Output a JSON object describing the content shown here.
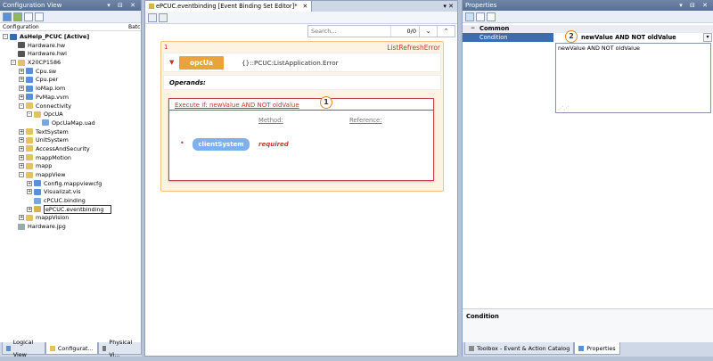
{
  "left_panel": {
    "title": "Configuration View",
    "title_controls": "▾ ⊟ ✕",
    "columns": [
      "Configuration",
      "Batc"
    ],
    "tree": [
      {
        "label": "AsHelp_PCUC [Active]",
        "indent": 1,
        "pm": "-",
        "icon": "#2f6db5",
        "bold": true
      },
      {
        "label": "Hardware.hw",
        "indent": 2,
        "pm": "",
        "icon": "#555"
      },
      {
        "label": "Hardware.hwl",
        "indent": 2,
        "pm": "",
        "icon": "#555"
      },
      {
        "label": "X20CP1586",
        "indent": 2,
        "pm": "-",
        "icon": "#e3c35b"
      },
      {
        "label": "Cpu.sw",
        "indent": 3,
        "pm": "+",
        "icon": "#5b8fd6"
      },
      {
        "label": "Cpu.per",
        "indent": 3,
        "pm": "+",
        "icon": "#5b8fd6"
      },
      {
        "label": "IoMap.iom",
        "indent": 3,
        "pm": "+",
        "icon": "#5b8fd6"
      },
      {
        "label": "PvMap.vvm",
        "indent": 3,
        "pm": "+",
        "icon": "#5b8fd6"
      },
      {
        "label": "Connectivity",
        "indent": 3,
        "pm": "-",
        "icon": "#e3c35b"
      },
      {
        "label": "OpcUA",
        "indent": 4,
        "pm": "-",
        "icon": "#e3c35b"
      },
      {
        "label": "OpcUaMap.uad",
        "indent": 5,
        "pm": "",
        "icon": "#7aa7d8"
      },
      {
        "label": "TextSystem",
        "indent": 3,
        "pm": "+",
        "icon": "#e3c35b"
      },
      {
        "label": "UnitSystem",
        "indent": 3,
        "pm": "+",
        "icon": "#e3c35b"
      },
      {
        "label": "AccessAndSecurity",
        "indent": 3,
        "pm": "+",
        "icon": "#e3c35b"
      },
      {
        "label": "mappMotion",
        "indent": 3,
        "pm": "+",
        "icon": "#e3c35b"
      },
      {
        "label": "mapp",
        "indent": 3,
        "pm": "+",
        "icon": "#e3c35b"
      },
      {
        "label": "mappView",
        "indent": 3,
        "pm": "-",
        "icon": "#e3c35b"
      },
      {
        "label": "Config.mappviewcfg",
        "indent": 4,
        "pm": "+",
        "icon": "#5b8fd6"
      },
      {
        "label": "Visualizat.vis",
        "indent": 4,
        "pm": "+",
        "icon": "#5b8fd6"
      },
      {
        "label": "cPCUC.binding",
        "indent": 4,
        "pm": "",
        "icon": "#7aa7d8"
      },
      {
        "label": "ePCUC.eventbinding",
        "indent": 4,
        "pm": "+",
        "icon": "#d8b24a",
        "selected": true
      },
      {
        "label": "mappVision",
        "indent": 3,
        "pm": "+",
        "icon": "#e3c35b"
      },
      {
        "label": "Hardware.jpg",
        "indent": 2,
        "pm": "",
        "icon": "#9aa"
      }
    ],
    "bottom_tabs": [
      "Logical View",
      "Configurat...",
      "Physical Vi..."
    ]
  },
  "editor": {
    "tab_title": "ePCUC.eventbinding [Event Binding Set Editor]*",
    "search_placeholder": "Search...",
    "search_count": "0/0",
    "event_index": "1",
    "event_type": "ListRefreshError",
    "source_widget": "opcUa",
    "source_path": "{}::PCUC:ListApplication.Error",
    "operands_label": "Operands:",
    "condition_link": "Execute if: newValue AND NOT oldValue",
    "method_header": "Method:",
    "reference_header": "Reference:",
    "operand_name": "clientSystem",
    "operand_status": "required",
    "callout_1": "1"
  },
  "properties": {
    "title": "Properties",
    "title_controls": "▾ ⊟ ✕",
    "category": "Common",
    "prop_name": "Condition",
    "prop_value": "newValue AND NOT oldValue",
    "editor_text": "newValue AND NOT oldValue",
    "callout_2": "2",
    "description_title": "Condition",
    "bottom_tabs": [
      "Toolbox - Event & Action Catalog",
      "Properties"
    ]
  },
  "colors": {
    "accent_orange": "#e8a33a",
    "event_border": "#f3c57a",
    "red_text": "#c0392b",
    "operand_blue": "#7fb0ec"
  }
}
